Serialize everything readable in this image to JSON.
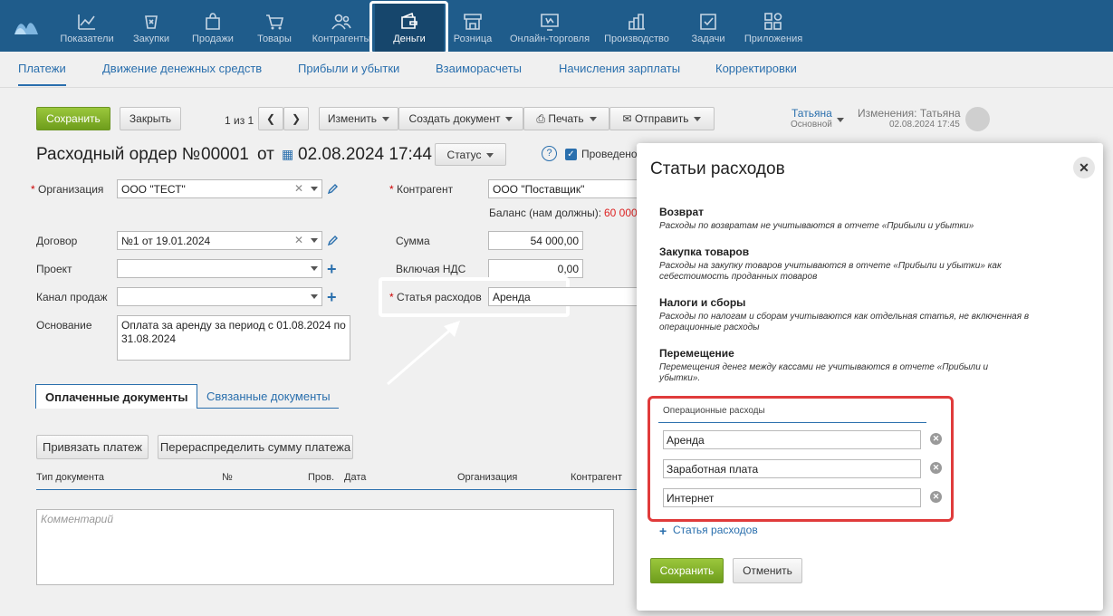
{
  "nav": {
    "items": [
      {
        "label": "Показатели",
        "icon": "chart-icon"
      },
      {
        "label": "Закупки",
        "icon": "purchase-icon"
      },
      {
        "label": "Продажи",
        "icon": "bag-icon"
      },
      {
        "label": "Товары",
        "icon": "cart-icon"
      },
      {
        "label": "Контрагенты",
        "icon": "people-icon"
      },
      {
        "label": "Деньги",
        "icon": "wallet-icon"
      },
      {
        "label": "Розница",
        "icon": "store-icon"
      },
      {
        "label": "Онлайн-торговля",
        "icon": "online-icon"
      },
      {
        "label": "Производство",
        "icon": "production-icon"
      },
      {
        "label": "Задачи",
        "icon": "tasks-icon"
      },
      {
        "label": "Приложения",
        "icon": "apps-icon"
      }
    ]
  },
  "subnav": [
    "Платежи",
    "Движение денежных средств",
    "Прибыли и убытки",
    "Взаиморасчеты",
    "Начисления зарплаты",
    "Корректировки"
  ],
  "toolbar": {
    "save": "Сохранить",
    "close": "Закрыть",
    "pager": "1 из 1",
    "edit": "Изменить",
    "create_doc": "Создать документ",
    "print": "Печать",
    "send": "Отправить"
  },
  "user": {
    "name": "Татьяна",
    "role": "Основной",
    "changes_label": "Изменения: Татьяна",
    "changes_date": "02.08.2024 17:45"
  },
  "doc": {
    "title": "Расходный ордер №",
    "number": "00001",
    "from": "от",
    "date": "02.08.2024 17:44",
    "status": "Статус",
    "posted": "Проведено"
  },
  "form": {
    "org_label": "Организация",
    "org_value": "ООО \"ТЕСТ\"",
    "contract_label": "Договор",
    "contract_value": "№1 от 19.01.2024",
    "project_label": "Проект",
    "channel_label": "Канал продаж",
    "basis_label": "Основание",
    "basis_value": "Оплата за аренду за период с 01.08.2024 по 31.08.2024",
    "counterparty_label": "Контрагент",
    "counterparty_value": "ООО \"Поставщик\"",
    "balance_label": "Баланс (нам должны):",
    "balance_value": "60 000",
    "sum_label": "Сумма",
    "sum_value": "54 000,00",
    "vat_label": "Включая НДС",
    "vat_value": "0,00",
    "expense_label": "Статья расходов",
    "expense_value": "Аренда"
  },
  "doc_tabs": {
    "paid": "Оплаченные документы",
    "linked": "Связанные документы"
  },
  "doc_buttons": {
    "bind": "Привязать платеж",
    "redistribute": "Перераспределить сумму платежа"
  },
  "table_headers": [
    "Тип документа",
    "№",
    "Пров.",
    "Дата",
    "Организация",
    "Контрагент"
  ],
  "comment_placeholder": "Комментарий",
  "modal": {
    "title": "Статьи расходов",
    "sections": [
      {
        "title": "Возврат",
        "desc": "Расходы по возвратам не учитываются в отчете «Прибыли и убытки»"
      },
      {
        "title": "Закупка товаров",
        "desc": "Расходы на закупку товаров учитываются в отчете «Прибыли и убытки» как себестоимость проданных товаров"
      },
      {
        "title": "Налоги и сборы",
        "desc": "Расходы по налогам и сборам учитываются как отдельная статья, не включенная в операционные расходы"
      },
      {
        "title": "Перемещение",
        "desc": "Перемещения денег между кассами не учитываются в отчете «Прибыли и убытки»."
      }
    ],
    "op_label": "Операционные расходы",
    "op_items": [
      "Аренда",
      "Заработная плата",
      "Интернет"
    ],
    "add": "Статья расходов",
    "save": "Сохранить",
    "cancel": "Отменить"
  }
}
